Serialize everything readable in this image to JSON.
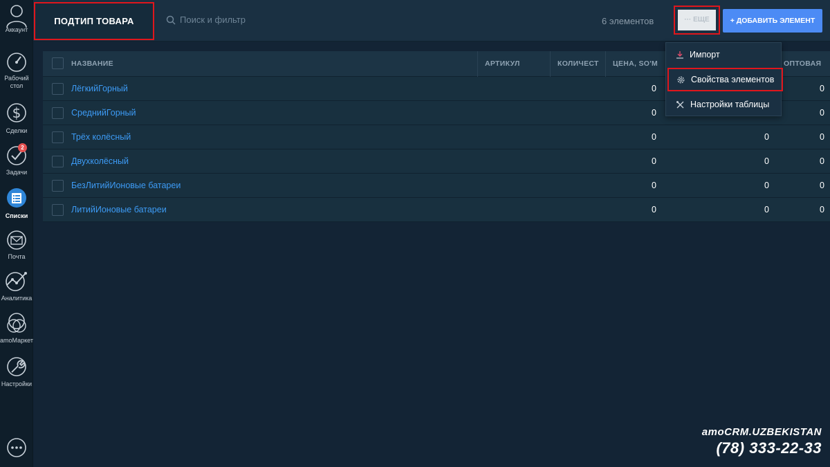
{
  "sidebar": {
    "items": [
      {
        "label": "Аккаунт",
        "icon": "user-icon",
        "active": false
      },
      {
        "label": "Рабочий стол",
        "icon": "dashboard-icon",
        "active": false
      },
      {
        "label": "Сделки",
        "icon": "dollar-icon",
        "active": false
      },
      {
        "label": "Задачи",
        "icon": "check-icon",
        "active": false,
        "badge": "2"
      },
      {
        "label": "Списки",
        "icon": "lists-icon",
        "active": true
      },
      {
        "label": "Почта",
        "icon": "mail-icon",
        "active": false
      },
      {
        "label": "Аналитика",
        "icon": "analytics-icon",
        "active": false
      },
      {
        "label": "amoМаркет",
        "icon": "market-icon",
        "active": false
      },
      {
        "label": "Настройки",
        "icon": "wrench-icon",
        "active": false
      }
    ],
    "chat_icon": "chat-icon"
  },
  "header": {
    "title": "ПОДТИП ТОВАРА",
    "search_placeholder": "Поиск и фильтр",
    "count": "6 элементов",
    "more_label": "··· ЕЩЕ",
    "add_label": "+ ДОБАВИТЬ ЭЛЕМЕНТ"
  },
  "dropdown": {
    "items": [
      {
        "label": "Импорт",
        "icon": "download-icon"
      },
      {
        "label": "Свойства элементов",
        "icon": "gear-icon"
      },
      {
        "label": "Настройки таблицы",
        "icon": "tools-icon"
      }
    ]
  },
  "table": {
    "columns": [
      "НАЗВАНИЕ",
      "АРТИКУЛ",
      "КОЛИЧЕСТ",
      "ЦЕНА, SO'M",
      "ОПТОВАЯ"
    ],
    "rows": [
      {
        "name": "ЛёгкийГорный",
        "values": [
          "0",
          "",
          "0"
        ]
      },
      {
        "name": "СреднийГорный",
        "values": [
          "0",
          "",
          "0"
        ]
      },
      {
        "name": "Трёх колёсный",
        "values": [
          "0",
          "0",
          "0"
        ]
      },
      {
        "name": "Двухколёсный",
        "values": [
          "0",
          "0",
          "0"
        ]
      },
      {
        "name": "БезЛитийИоновые батареи",
        "values": [
          "0",
          "0",
          "0"
        ]
      },
      {
        "name": "ЛитийИоновые батареи",
        "values": [
          "0",
          "0",
          "0"
        ]
      }
    ]
  },
  "watermark": {
    "brand": "amoCRM.UZBEKISTAN",
    "phone": "(78) 333-22-33"
  },
  "colors": {
    "accent_blue": "#4c8bf5",
    "link_blue": "#3d9bf5",
    "highlight_red": "#e0161c",
    "badge_red": "#e55151"
  }
}
